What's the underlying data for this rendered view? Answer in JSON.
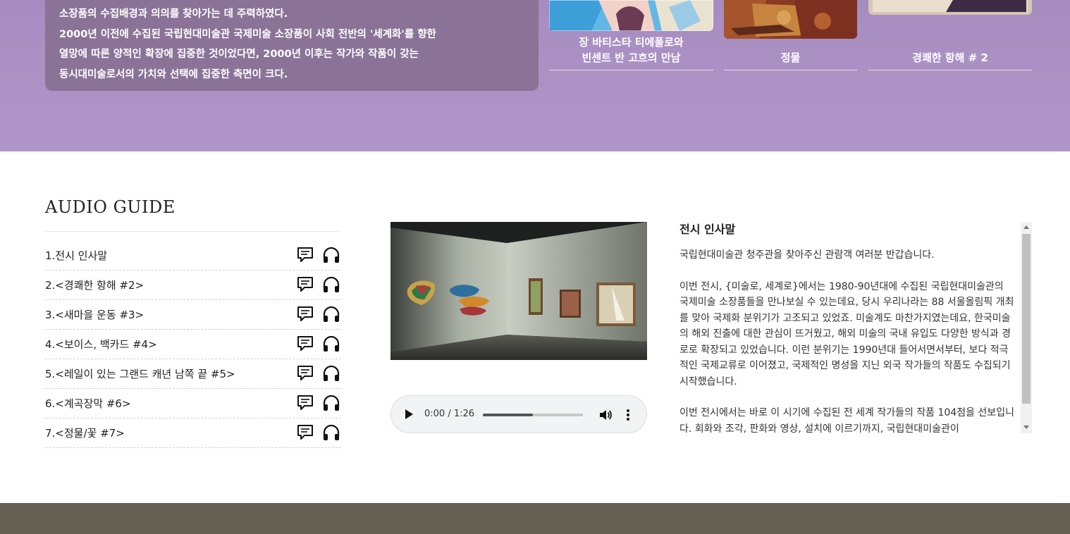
{
  "intro": {
    "lines": [
      "소장품의 수집배경과 의의를 찾아가는 데 주력하였다.",
      "2000년 이전에 수집된 국립현대미술관 국제미술 소장품이 사회 전반의 '세계화'를 향한",
      "열망에 따른 양적인 확장에 집중한 것이었다면, 2000년 이후는 작가와 작품이 갖는",
      "동시대미술로서의 가치와 선택에 집중한 측면이 크다."
    ]
  },
  "artworks": [
    {
      "caption_line1": "장 바티스타 티에폴로와",
      "caption_line2": "빈센트 반 고흐의 만남"
    },
    {
      "caption_line1": "정물",
      "caption_line2": ""
    },
    {
      "caption_line1": "경쾌한 항해 # 2",
      "caption_line2": ""
    }
  ],
  "audio_guide": {
    "title": "AUDIO GUIDE",
    "items": [
      {
        "label": "1.전시 인사말"
      },
      {
        "label": "2.<경쾌한 항해 #2>"
      },
      {
        "label": "3.<새마을 운동 #3>"
      },
      {
        "label": "4.<보이스, 백카드 #4>"
      },
      {
        "label": "5.<레일이 있는 그랜드 캐년 남쪽 끝 #5>"
      },
      {
        "label": "6.<계곡장막 #6>"
      },
      {
        "label": "7.<정물/꽃 #7>"
      }
    ],
    "icons": {
      "text": "chat-bubble-icon",
      "audio": "headphones-icon"
    }
  },
  "player": {
    "time": "0:00 / 1:26",
    "progress": 0.5,
    "play_icon": "play-icon",
    "volume_icon": "volume-icon",
    "more_icon": "more-vertical-icon"
  },
  "transcript": {
    "title": "전시 인사말",
    "paragraphs": [
      "국립현대미술관 청주관을 찾아주신 관람객 여러분 반갑습니다.",
      "이번 전시, {미술로, 세계로}에서는 1980-90년대에 수집된 국립현대미술관의 국제미술 소장품들을 만나보실 수 있는데요, 당시 우리나라는 88 서울올림픽 개최를 맞아 국제화 분위기가 고조되고 있었죠. 미술계도 마찬가지였는데요, 한국미술의 해외 진출에 대한 관심이 뜨거웠고, 해외 미술의 국내 유입도 다양한 방식과 경로로 확장되고 있었습니다. 이런 분위기는 1990년대 들어서면서부터, 보다 적극적인 국제교류로 이어졌고, 국제적인 명성을 지닌 외국 작가들의 작품도 수집되기 시작했습니다.",
      "이번 전시에서는 바로 이 시기에 수집된 전 세계 작가들의 작품 104점을 선보입니다. 회화와 조각, 판화와 영상, 설치에 이르기까지, 국립현대미술관이"
    ]
  },
  "colors": {
    "header_band": "#ad93c5",
    "intro_box": "#8a7397",
    "footer": "#666054"
  }
}
